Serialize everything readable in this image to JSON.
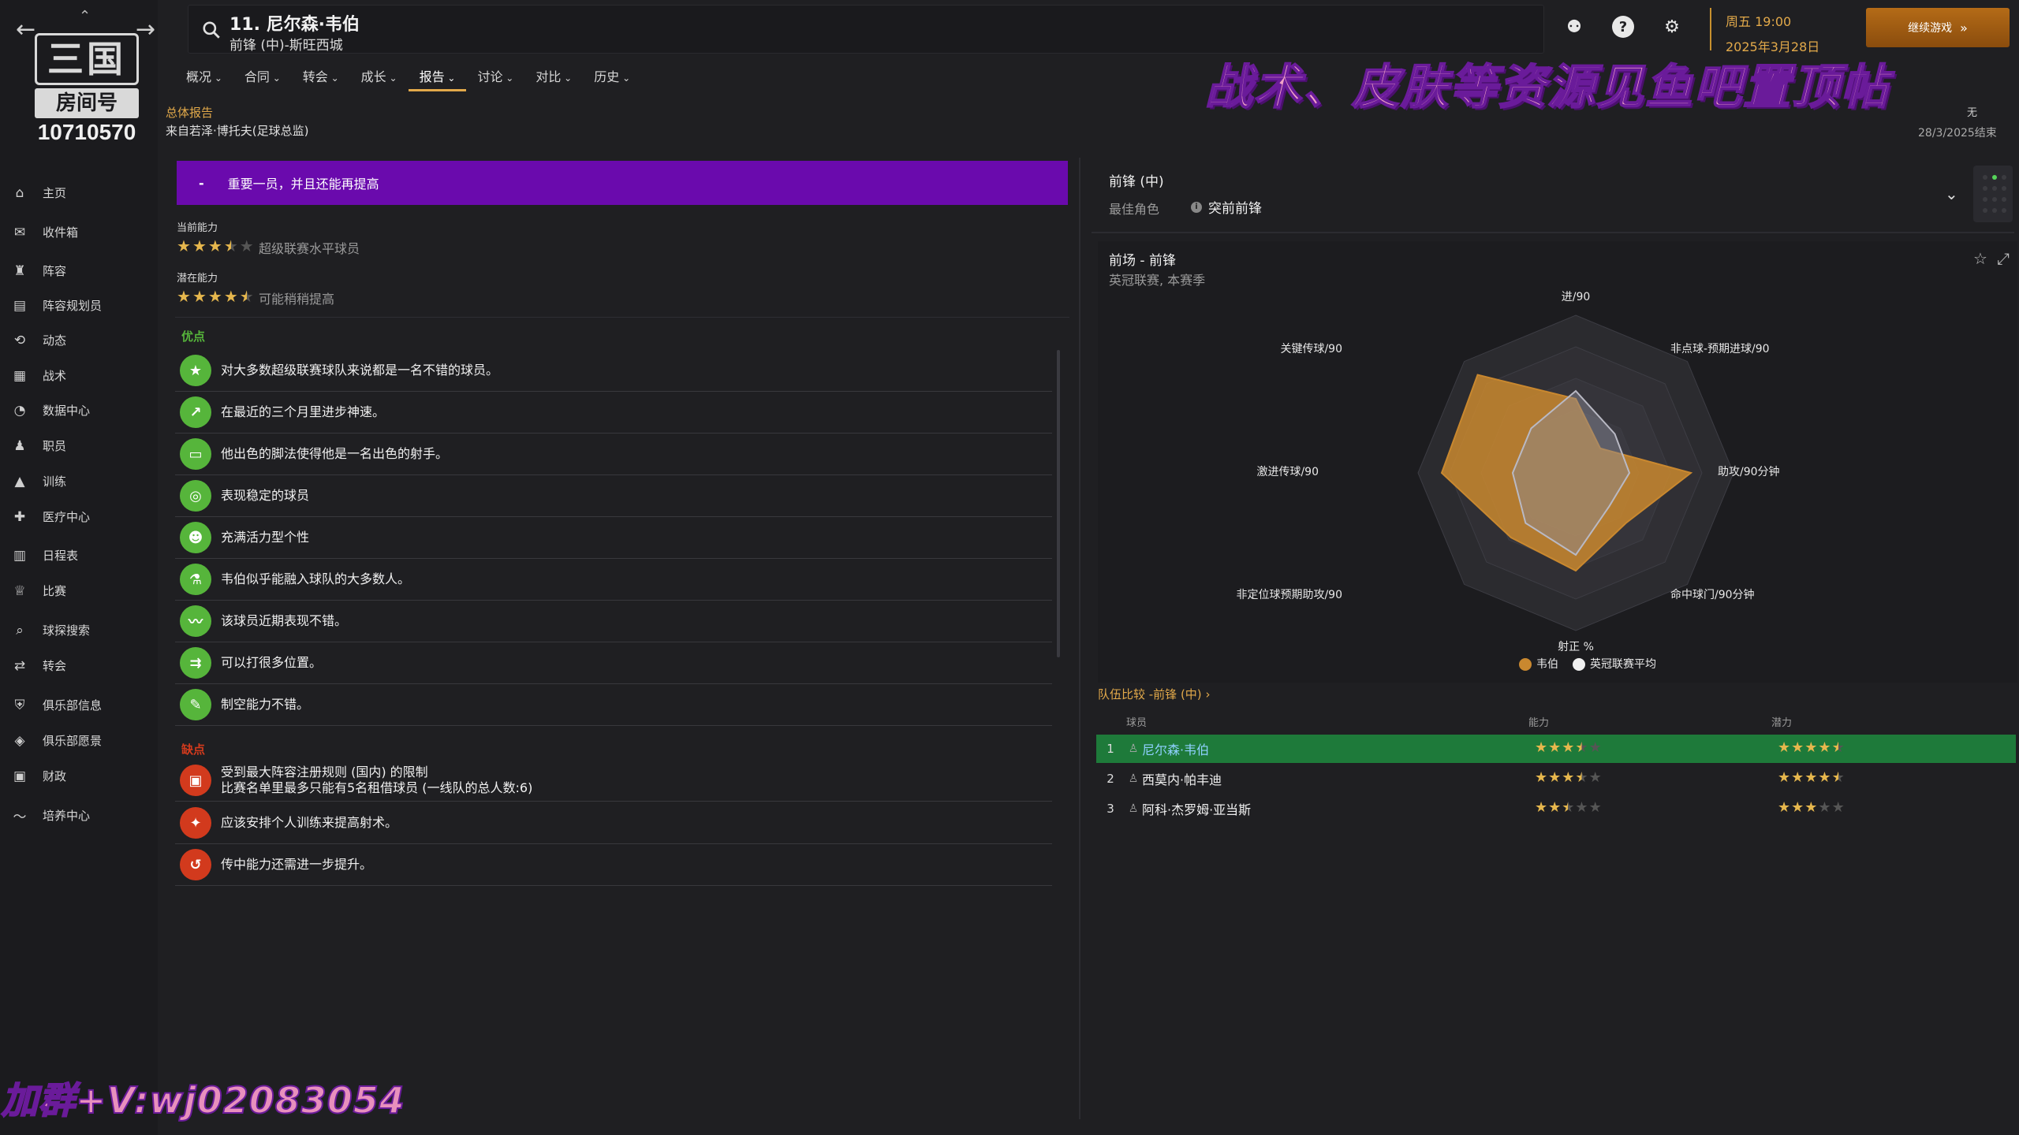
{
  "nav": {
    "logo_mark": "三国",
    "logo_tag": "房间号",
    "logo_number": "10710570",
    "items": [
      {
        "label": "主页",
        "icon": "home-icon"
      },
      {
        "label": "收件箱",
        "icon": "inbox-icon"
      },
      {
        "label": "阵容",
        "icon": "squad-icon"
      },
      {
        "label": "阵容规划员",
        "icon": "clipboard-icon"
      },
      {
        "label": "动态",
        "icon": "dynamics-icon"
      },
      {
        "label": "战术",
        "icon": "tactics-icon"
      },
      {
        "label": "数据中心",
        "icon": "data-hub-icon"
      },
      {
        "label": "职员",
        "icon": "staff-icon"
      },
      {
        "label": "训练",
        "icon": "training-icon"
      },
      {
        "label": "医疗中心",
        "icon": "medical-icon"
      },
      {
        "label": "日程表",
        "icon": "calendar-icon"
      },
      {
        "label": "比赛",
        "icon": "trophy-icon"
      },
      {
        "label": "球探搜索",
        "icon": "search-icon"
      },
      {
        "label": "转会",
        "icon": "transfer-icon"
      },
      {
        "label": "俱乐部信息",
        "icon": "shield-icon"
      },
      {
        "label": "俱乐部愿景",
        "icon": "vision-icon"
      },
      {
        "label": "财政",
        "icon": "finance-icon"
      },
      {
        "label": "培养中心",
        "icon": "development-icon"
      }
    ]
  },
  "header": {
    "player_title": "11. 尼尔森·韦伯",
    "player_sub": "前锋 (中)-斯旺西城",
    "date_line1": "周五 19:00",
    "date_line2": "2025年3月28日",
    "continue_label": "继续游戏"
  },
  "tabs": [
    {
      "label": "概况",
      "active": false
    },
    {
      "label": "合同",
      "active": false
    },
    {
      "label": "转会",
      "active": false
    },
    {
      "label": "成长",
      "active": false
    },
    {
      "label": "报告",
      "active": true
    },
    {
      "label": "讨论",
      "active": false
    },
    {
      "label": "对比",
      "active": false
    },
    {
      "label": "历史",
      "active": false
    }
  ],
  "report": {
    "title": "总体报告",
    "source": "来自若泽·博托夫(足球总监)",
    "meta_right_top": "无",
    "meta_right_date": "28/3/2025结束",
    "banner": "重要一员，并且还能再提高",
    "current_ability_label": "当前能力",
    "current_ability_stars": 3.5,
    "current_ability_text": "超级联赛水平球员",
    "potential_label": "潜在能力",
    "potential_stars": 4.5,
    "potential_text": "可能稍稍提高",
    "strengths_label": "优点",
    "strengths": [
      "对大多数超级联赛球队来说都是一名不错的球员。",
      "在最近的三个月里进步神速。",
      "他出色的脚法使得他是一名出色的射手。",
      "表现稳定的球员",
      "充满活力型个性",
      "韦伯似乎能融入球队的大多数人。",
      "该球员近期表现不错。",
      "可以打很多位置。",
      "制空能力不错。"
    ],
    "weaknesses_label": "缺点",
    "weaknesses": [
      "受到最大阵容注册规则 (国内) 的限制\n比赛名单里最多只能有5名租借球员 (一线队的总人数:6)",
      "应该安排个人训练来提高射术。",
      "传中能力还需进一步提升。"
    ]
  },
  "role": {
    "position": "前锋 (中)",
    "best_role_label": "最佳角色",
    "best_role": "突前前锋"
  },
  "radar": {
    "title": "前场 - 前锋",
    "subtitle": "英冠联赛, 本赛季",
    "axes": [
      "进/90",
      "非点球-预期进球/90",
      "助攻/90分钟",
      "命中球门/90分钟",
      "射正 %",
      "非定位球预期助攻/90",
      "激进传球/90",
      "关键传球/90"
    ],
    "player_values": [
      0.47,
      0.22,
      0.73,
      0.45,
      0.62,
      0.58,
      0.85,
      0.88
    ],
    "league_avg_values": [
      0.52,
      0.35,
      0.34,
      0.3,
      0.52,
      0.45,
      0.4,
      0.4
    ],
    "player_color": "#c9882f",
    "average_color": "#8c8c99",
    "legend_player": "韦伯",
    "legend_avg": "英冠联赛平均"
  },
  "team_compare": {
    "label": "队伍比较 -前锋 (中)",
    "col_player": "球员",
    "col_ability": "能力",
    "col_potential": "潜力",
    "rows": [
      {
        "rank": "1",
        "name": "尼尔森·韦伯",
        "ability": 3.5,
        "potential": 4.5
      },
      {
        "rank": "2",
        "name": "西莫内·帕丰迪",
        "ability": 3.5,
        "potential": 4.5
      },
      {
        "rank": "3",
        "name": "阿科·杰罗姆·亚当斯",
        "ability": 2.5,
        "potential": 3
      }
    ]
  },
  "overlays": {
    "banner": "战术、皮肤等资源见鱼吧置顶帖",
    "bottom": "加群+V:wj02083054"
  }
}
